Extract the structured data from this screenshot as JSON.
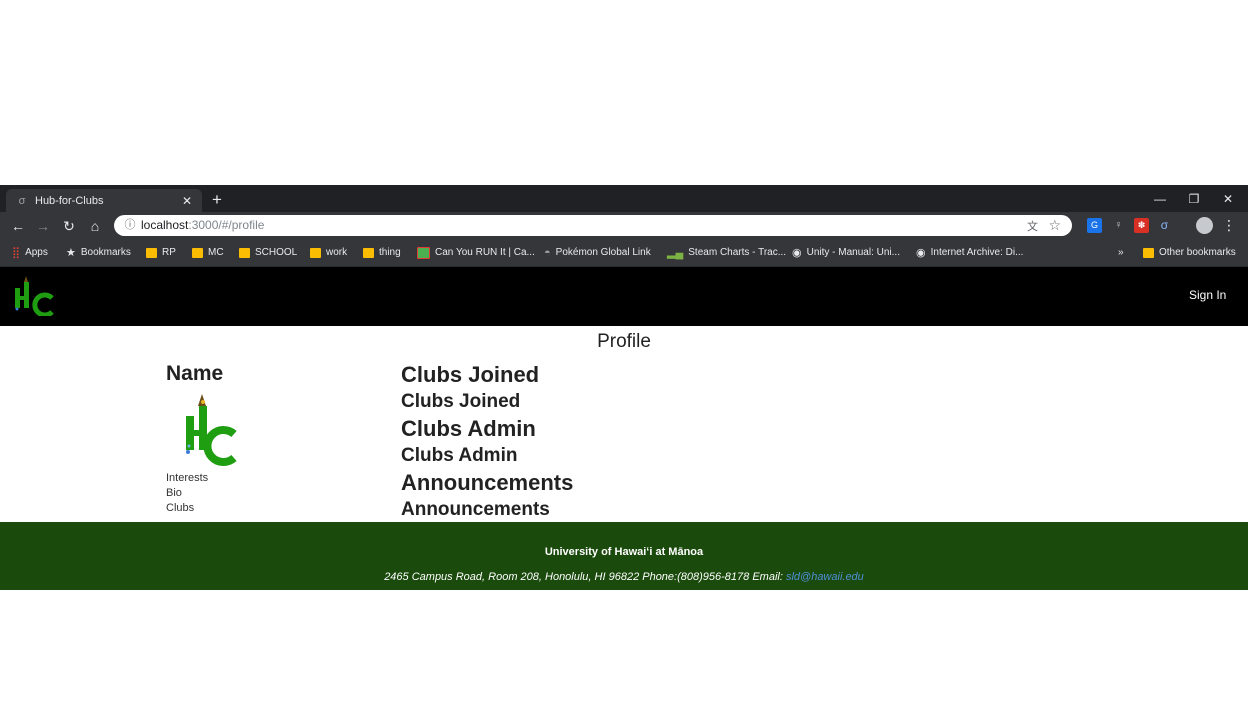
{
  "browser": {
    "tab_title": "Hub-for-Clubs",
    "url_host": "localhost",
    "url_path": ":3000/#/profile",
    "bookmarks": [
      {
        "label": "Apps",
        "icon": "apps-grid-icon"
      },
      {
        "label": "Bookmarks",
        "icon": "star-icon"
      },
      {
        "label": "RP",
        "icon": "folder-icon"
      },
      {
        "label": "MC",
        "icon": "folder-icon"
      },
      {
        "label": "SCHOOL",
        "icon": "folder-icon"
      },
      {
        "label": "work",
        "icon": "folder-icon"
      },
      {
        "label": "thing",
        "icon": "folder-icon"
      },
      {
        "label": "Can You RUN It | Ca...",
        "icon": "site-icon"
      },
      {
        "label": "Pokémon Global Link",
        "icon": "pokeball-icon"
      },
      {
        "label": "Steam Charts - Trac...",
        "icon": "chart-icon"
      },
      {
        "label": "Unity - Manual: Uni...",
        "icon": "globe-icon"
      },
      {
        "label": "Internet Archive: Di...",
        "icon": "globe-icon"
      }
    ],
    "overflow_label": "»",
    "other_bookmarks": "Other bookmarks"
  },
  "navbar": {
    "logo_text": "HC",
    "signin_label": "Sign In"
  },
  "profile": {
    "page_title": "Profile",
    "name_heading": "Name",
    "info_items": [
      "Interests",
      "Bio",
      "Clubs"
    ],
    "sections": [
      {
        "heading": "Clubs Joined",
        "subheading": "Clubs Joined"
      },
      {
        "heading": "Clubs Admin",
        "subheading": "Clubs Admin"
      },
      {
        "heading": "Announcements",
        "subheading": "Announcements"
      }
    ]
  },
  "footer": {
    "university": "University of Hawaiʻi at Mānoa",
    "address": "2465 Campus Road, Room 208, Honolulu, HI 96822 Phone:(808)956-8178",
    "email_label": "Email:",
    "email": "sld@hawaii.edu"
  },
  "colors": {
    "navbar_bg": "#000000",
    "footer_bg": "#1a4a0c",
    "logo_green": "#1f9e12",
    "link_blue": "#4f8ed8"
  }
}
